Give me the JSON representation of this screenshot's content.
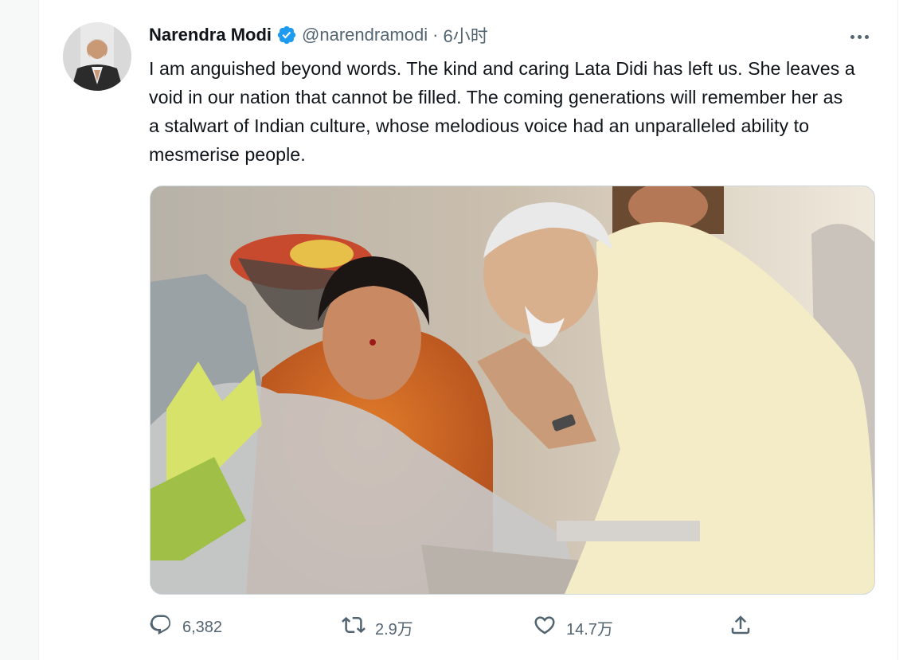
{
  "tweet": {
    "author": {
      "name": "Narendra Modi",
      "handle": "@narendramodi",
      "verified": true,
      "avatar_icon": "avatar-photo"
    },
    "separator": "·",
    "timestamp": "6小时",
    "text": "I am anguished beyond words. The kind and caring Lata Didi has left us. She leaves a void in our nation that cannot be filled. The coming generations will remember her as a stalwart of Indian culture, whose melodious voice had an unparalleled ability to mesmerise people.",
    "media": {
      "icon": "photo"
    },
    "actions": {
      "reply": {
        "icon": "reply-icon",
        "count": "6,382"
      },
      "retweet": {
        "icon": "retweet-icon",
        "count": "2.9万"
      },
      "like": {
        "icon": "heart-icon",
        "count": "14.7万"
      },
      "share": {
        "icon": "share-icon"
      }
    }
  },
  "colors": {
    "text": "#0f1419",
    "secondary": "#536471",
    "verified": "#1d9bf0",
    "border": "#cfd9de"
  }
}
